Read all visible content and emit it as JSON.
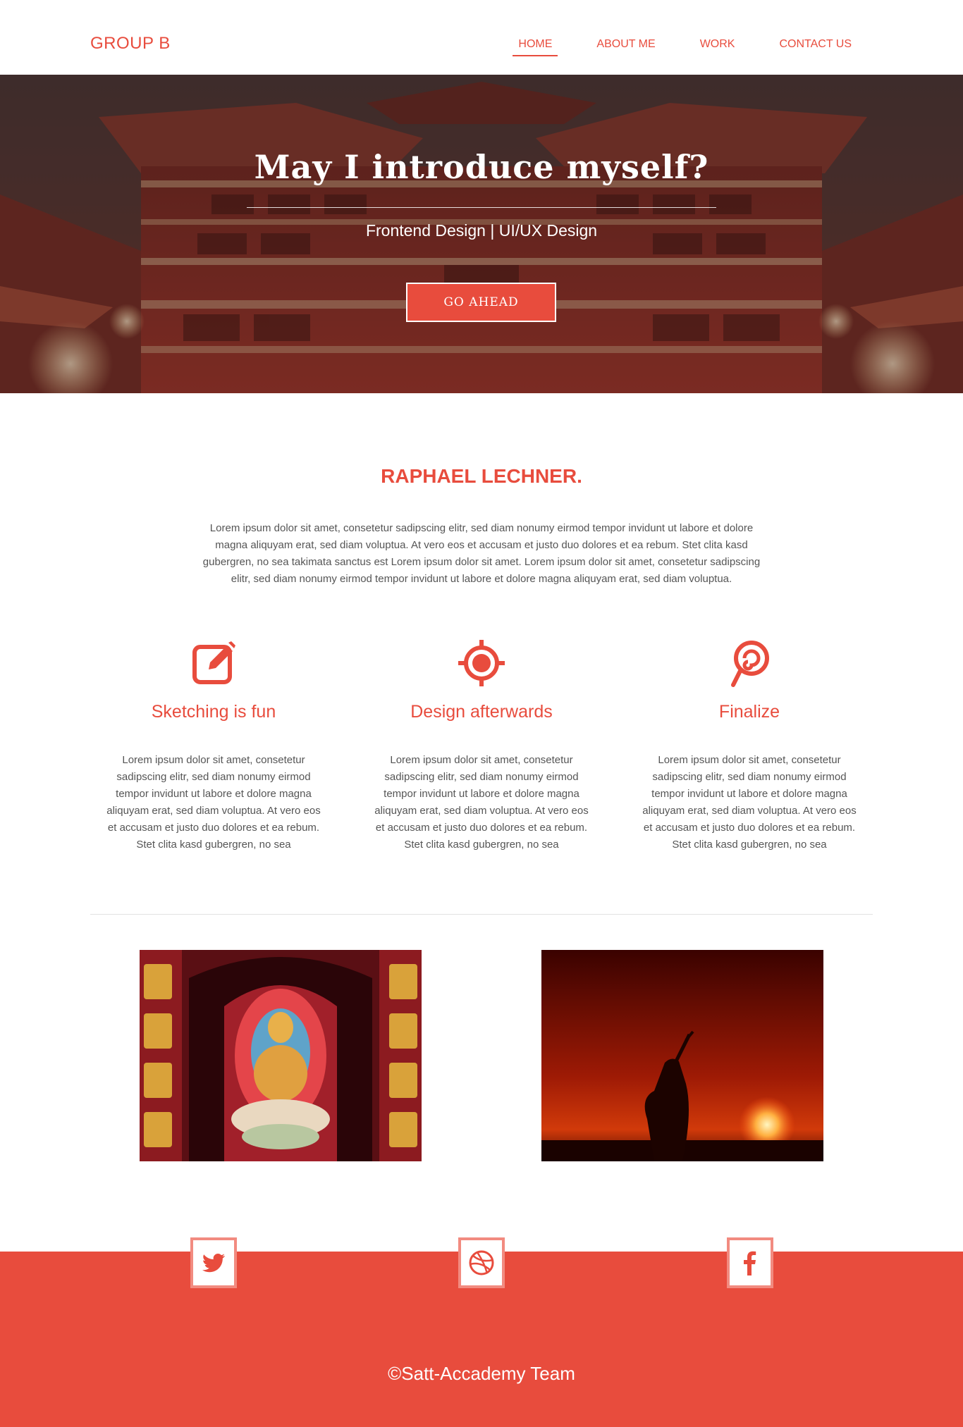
{
  "brand": {
    "logo": "GROUP B",
    "accent": "#e84c3d"
  },
  "nav": {
    "items": [
      {
        "label": "HOME",
        "active": true
      },
      {
        "label": "ABOUT ME",
        "active": false
      },
      {
        "label": "WORK",
        "active": false
      },
      {
        "label": "CONTACT US",
        "active": false
      }
    ]
  },
  "hero": {
    "title": "May I introduce myself?",
    "subtitle": "Frontend Design | UI/UX Design",
    "button": "GO AHEAD"
  },
  "about": {
    "title": "RAPHAEL LECHNER.",
    "text": "Lorem ipsum dolor sit amet, consetetur sadipscing elitr, sed diam nonumy eirmod tempor invidunt ut labore et dolore magna aliquyam erat, sed diam voluptua. At vero eos et accusam et justo duo dolores et ea rebum. Stet clita kasd gubergren, no sea takimata sanctus est Lorem ipsum dolor sit amet. Lorem ipsum dolor sit amet, consetetur sadipscing elitr, sed diam nonumy eirmod tempor invidunt ut labore et dolore magna aliquyam erat, sed diam voluptua."
  },
  "features": [
    {
      "icon": "edit-icon",
      "title": "Sketching is fun",
      "text": "Lorem ipsum dolor sit amet, consetetur sadipscing elitr, sed diam nonumy eirmod tempor invidunt ut labore et dolore magna aliquyam erat, sed diam voluptua. At vero eos et accusam et justo duo dolores et ea rebum. Stet clita kasd gubergren, no sea"
    },
    {
      "icon": "crosshair-icon",
      "title": "Design afterwards",
      "text": "Lorem ipsum dolor sit amet, consetetur sadipscing elitr, sed diam nonumy eirmod tempor invidunt ut labore et dolore magna aliquyam erat, sed diam voluptua. At vero eos et accusam et justo duo dolores et ea rebum. Stet clita kasd gubergren, no sea"
    },
    {
      "icon": "lollipop-icon",
      "title": "Finalize",
      "text": "Lorem ipsum dolor sit amet, consetetur sadipscing elitr, sed diam nonumy eirmod tempor invidunt ut labore et dolore magna aliquyam erat, sed diam voluptua. At vero eos et accusam et justo duo dolores et ea rebum. Stet clita kasd gubergren, no sea"
    }
  ],
  "gallery": [
    {
      "icon": "buddha-statue-image"
    },
    {
      "icon": "sunset-silhouette-image"
    }
  ],
  "footer": {
    "social": [
      {
        "icon": "twitter-icon"
      },
      {
        "icon": "dribbble-icon"
      },
      {
        "icon": "facebook-icon"
      }
    ],
    "copyright": "©Satt-Accademy Team"
  }
}
